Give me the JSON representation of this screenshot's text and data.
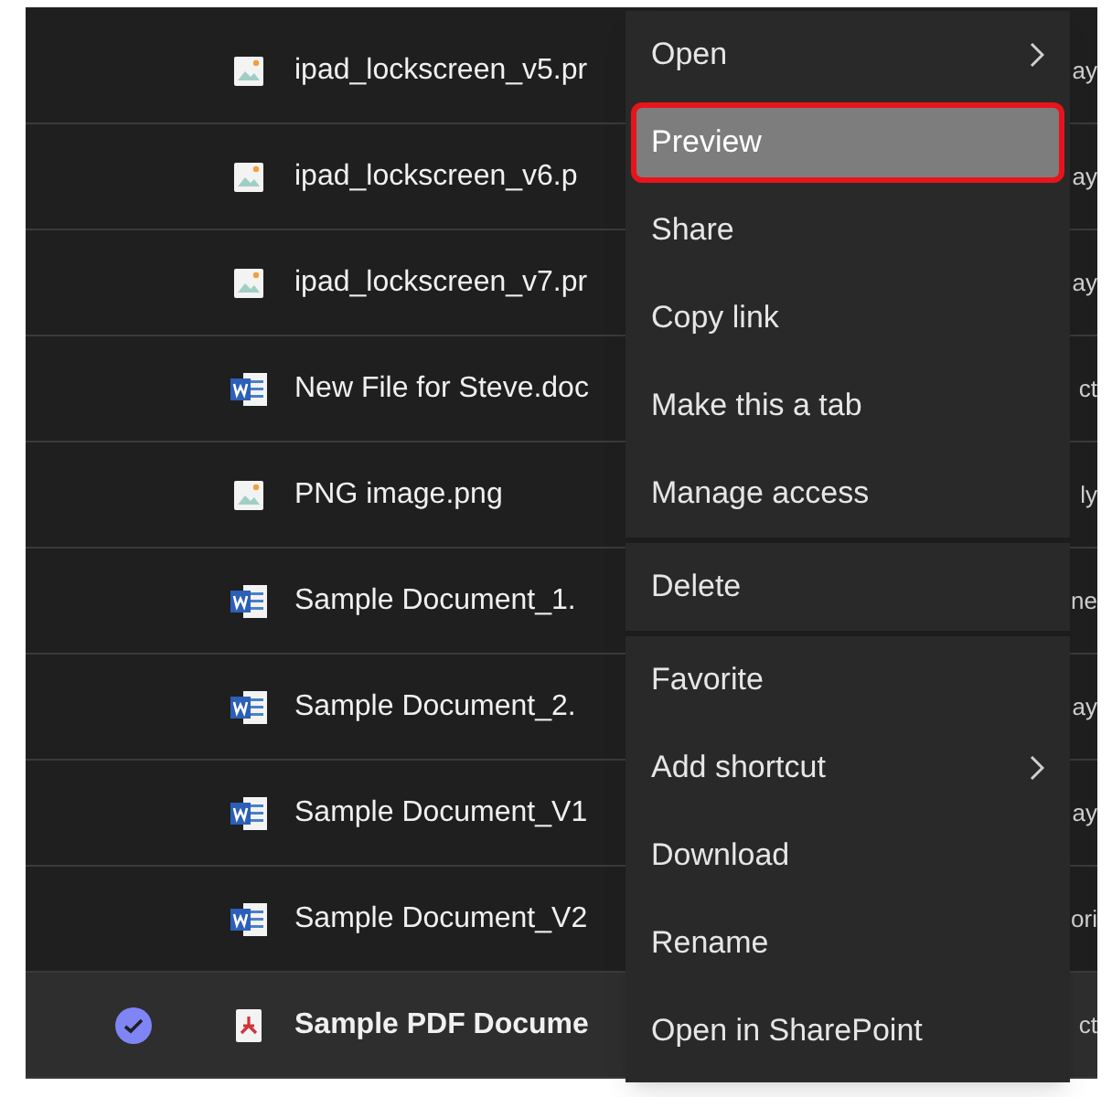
{
  "files": [
    {
      "name": "ipad_lockscreen_v5.pr",
      "kind": "image",
      "column_3": "ay",
      "selected": false
    },
    {
      "name": "ipad_lockscreen_v6.p",
      "kind": "image",
      "column_3": "ay",
      "selected": false
    },
    {
      "name": "ipad_lockscreen_v7.pr",
      "kind": "image",
      "column_3": "ay",
      "selected": false
    },
    {
      "name": "New File for Steve.doc",
      "kind": "word",
      "column_3": "ct",
      "selected": false
    },
    {
      "name": "PNG image.png",
      "kind": "image",
      "column_3": "ly",
      "selected": false
    },
    {
      "name": "Sample Document_1.",
      "kind": "word",
      "column_3": "ne",
      "selected": false
    },
    {
      "name": "Sample Document_2.",
      "kind": "word",
      "column_3": "ay",
      "selected": false
    },
    {
      "name": "Sample Document_V1",
      "kind": "word",
      "column_3": "ay",
      "selected": false
    },
    {
      "name": "Sample Document_V2",
      "kind": "word",
      "column_3": "ori",
      "selected": false
    },
    {
      "name": "Sample PDF Docume",
      "kind": "pdf",
      "column_3": "ct",
      "selected": true
    }
  ],
  "context_menu": {
    "groups": [
      [
        {
          "label": "Open",
          "submenu": true,
          "selected": false
        },
        {
          "label": "Preview",
          "submenu": false,
          "selected": true
        },
        {
          "label": "Share",
          "submenu": false,
          "selected": false
        },
        {
          "label": "Copy link",
          "submenu": false,
          "selected": false
        },
        {
          "label": "Make this a tab",
          "submenu": false,
          "selected": false
        },
        {
          "label": "Manage access",
          "submenu": false,
          "selected": false
        }
      ],
      [
        {
          "label": "Delete",
          "submenu": false,
          "selected": false
        }
      ],
      [
        {
          "label": "Favorite",
          "submenu": false,
          "selected": false
        },
        {
          "label": "Add shortcut",
          "submenu": true,
          "selected": false
        },
        {
          "label": "Download",
          "submenu": false,
          "selected": false
        },
        {
          "label": "Rename",
          "submenu": false,
          "selected": false
        },
        {
          "label": "Open in SharePoint",
          "submenu": false,
          "selected": false
        }
      ]
    ]
  }
}
